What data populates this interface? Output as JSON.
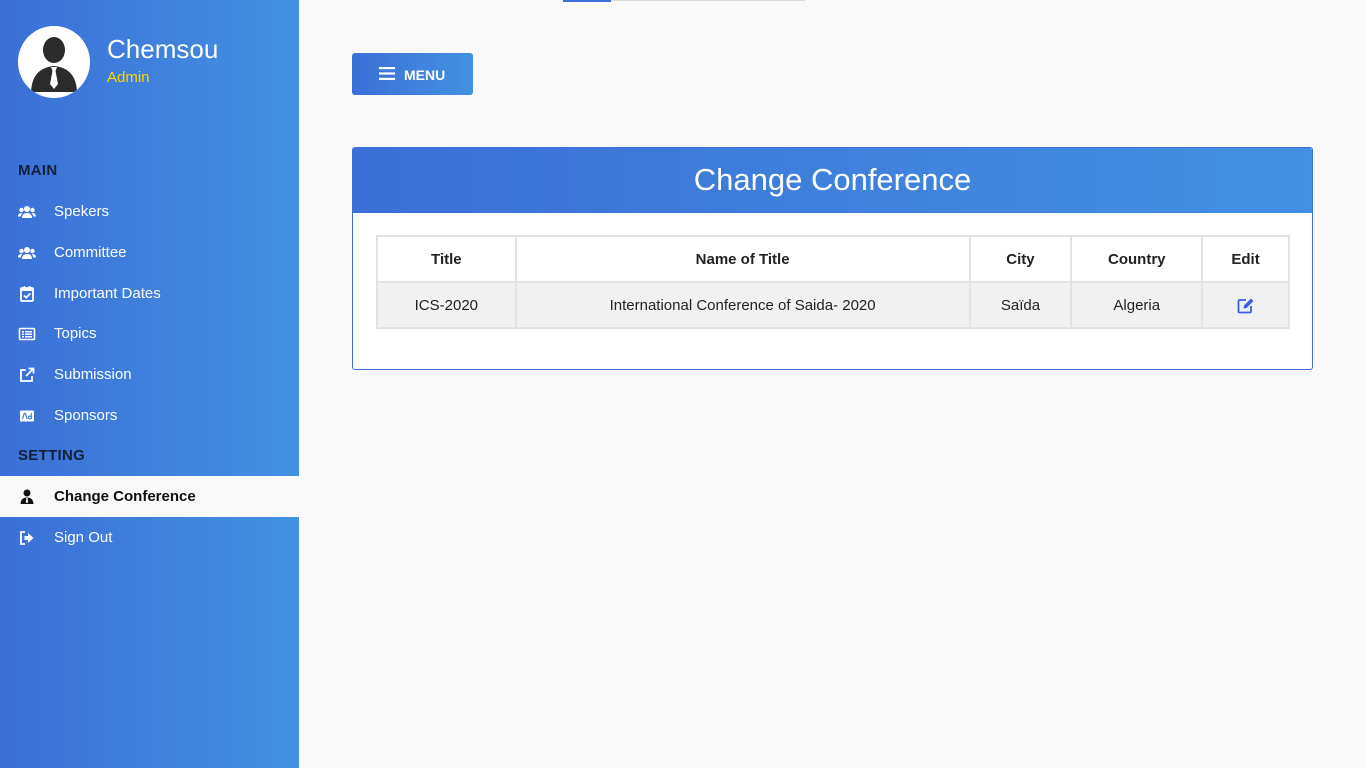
{
  "user": {
    "name": "Chemsou",
    "role": "Admin"
  },
  "sidebar": {
    "sections": [
      {
        "label": "MAIN"
      },
      {
        "label": "SETTING"
      }
    ],
    "items": [
      {
        "label": "Spekers",
        "icon": "users-icon"
      },
      {
        "label": "Committee",
        "icon": "users-icon"
      },
      {
        "label": "Important Dates",
        "icon": "calendar-check-icon"
      },
      {
        "label": "Topics",
        "icon": "list-icon"
      },
      {
        "label": "Submission",
        "icon": "external-link-icon"
      },
      {
        "label": "Sponsors",
        "icon": "ad-icon"
      },
      {
        "label": "Change Conference",
        "icon": "user-tie-icon",
        "active": true
      },
      {
        "label": "Sign Out",
        "icon": "sign-out-icon"
      }
    ]
  },
  "toolbar": {
    "menu_label": "MENU"
  },
  "card": {
    "title": "Change Conference",
    "columns": [
      "Title",
      "Name of Title",
      "City",
      "Country",
      "Edit"
    ],
    "rows": [
      {
        "title": "ICS-2020",
        "name": "International Conference of Saida- 2020",
        "city": "Saïda",
        "country": "Algeria"
      }
    ]
  },
  "colors": {
    "accent_start": "#3b6fd6",
    "accent_end": "#4391e2",
    "role": "#ffd700",
    "edit_icon": "#3b5de7"
  }
}
